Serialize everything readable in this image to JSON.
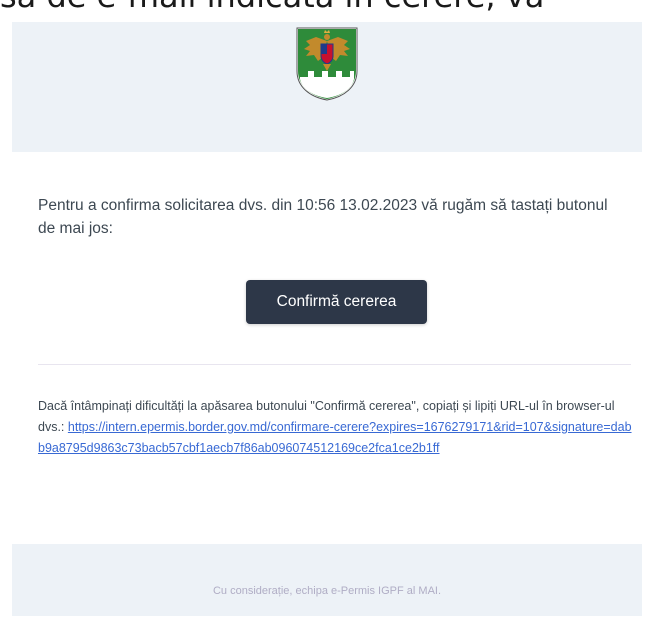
{
  "top_strip": {
    "text": "să de e-mail indicată în cerere, vă"
  },
  "header": {
    "logo_icon": "moldova-coat-of-arms-icon"
  },
  "content": {
    "intro_text": "Pentru a confirma solicitarea dvs. din 10:56 13.02.2023 vă rugăm să tastați butonul de mai jos:",
    "button_label": "Confirmă cererea",
    "subcopy_text": "Dacă întâmpinați dificultăți la apăsarea butonului \"Confirmă cererea\", copiați și lipiți URL-ul în browser-ul dvs.: ",
    "link_text": "https://intern.epermis.border.gov.md/confirmare-cerere?expires=1676279171&rid=107&signature=dabb9a8795d9863c73bacb57cbf1aecb7f86ab096074512169ce2fca1ce2b1ff"
  },
  "footer": {
    "text": "Cu considerație, echipa e-Permis IGPF al MAI."
  },
  "colors": {
    "header_bg": "#edf2f7",
    "button_bg": "#2d3748",
    "link": "#3869d4",
    "text": "#3d4852",
    "footer_text": "#b0adc5"
  }
}
